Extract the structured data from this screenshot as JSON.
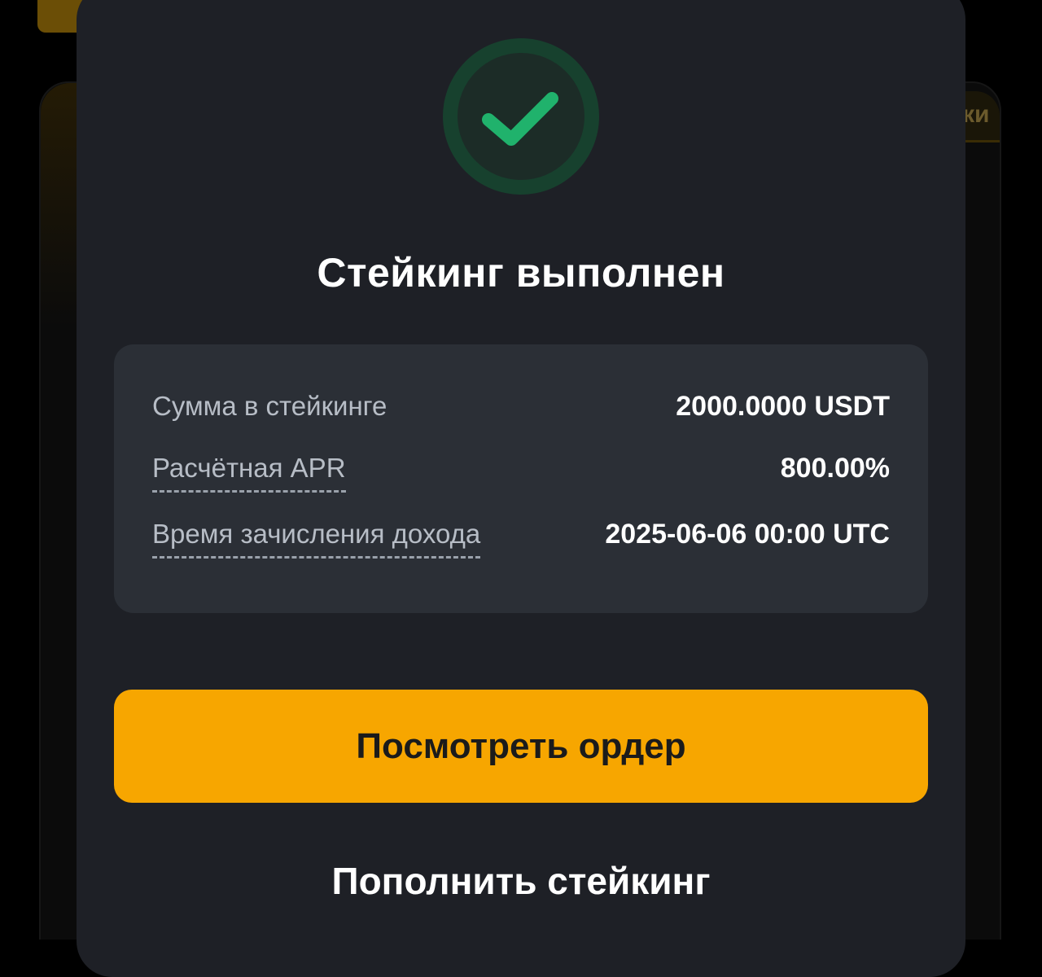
{
  "background": {
    "tab_text": "ки"
  },
  "modal": {
    "status_icon": "success-check-icon",
    "title": "Стейкинг выполнен",
    "details": [
      {
        "label": "Сумма в стейкинге",
        "value": "2000.0000 USDT"
      },
      {
        "label": "Расчётная APR",
        "value": "800.00%"
      },
      {
        "label": "Время зачисления дохода",
        "value": "2025-06-06 00:00 UTC"
      }
    ],
    "primary_button": "Посмотреть ордер",
    "secondary_button": "Пополнить стейкинг"
  },
  "colors": {
    "accent": "#f7a600",
    "success": "#20b26c",
    "modal_bg": "#1e2026",
    "card_bg": "#2b2f36"
  }
}
